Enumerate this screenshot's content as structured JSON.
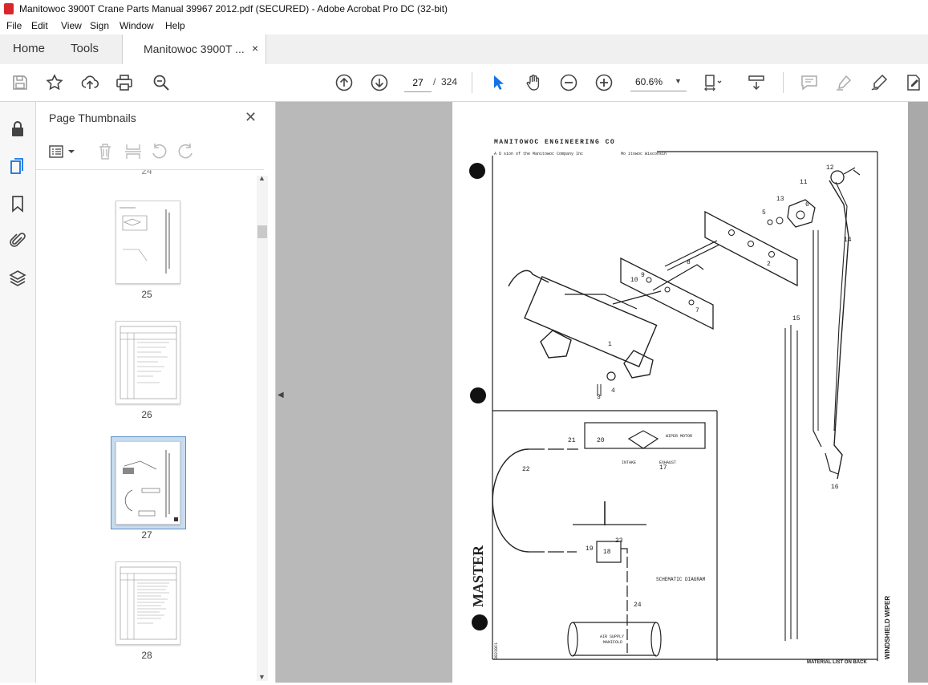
{
  "window": {
    "title": "Manitowoc 3900T Crane Parts Manual 39967 2012.pdf (SECURED) - Adobe Acrobat Pro DC (32-bit)"
  },
  "menu": [
    "File",
    "Edit",
    "View",
    "Sign",
    "Window",
    "Help"
  ],
  "tabs": {
    "home": "Home",
    "tools": "Tools",
    "document": "Manitowoc 3900T ...",
    "close": "×"
  },
  "toolbar": {
    "current_page": "27",
    "separator": "/",
    "total_pages": "324",
    "zoom": "60.6%",
    "icons": [
      "save-icon",
      "bookmark-star-icon",
      "upload-icon",
      "print-icon",
      "zoom-search-icon",
      "page-up-icon",
      "page-down-icon",
      "select-cursor-icon",
      "hand-icon",
      "zoom-out-icon",
      "zoom-in-icon",
      "page-fit-icon",
      "scroll-mode-icon",
      "comment-icon",
      "highlight-icon",
      "sign-icon",
      "edit-pdf-icon"
    ]
  },
  "panel": {
    "title": "Page Thumbnails",
    "close": "✕",
    "partial_label": "24",
    "thumbnails": [
      {
        "label": "25",
        "selected": false
      },
      {
        "label": "26",
        "selected": false
      },
      {
        "label": "27",
        "selected": true
      },
      {
        "label": "28",
        "selected": false
      }
    ]
  },
  "document_page": {
    "header": "MANITOWOC ENGINEERING CO",
    "subheader_left": "A D   sion of the Manitowoc Company Inc",
    "subheader_right": "Mo itowoc Wisconsin",
    "schematic_label": "SCHEMATIC DIAGRAM",
    "wiper_motor": "WIPER MOTOR",
    "intake": "INTAKE",
    "exhaust": "EXHAUST",
    "air_supply": "AIR SUPPLY",
    "manifold": "MANIFOLD",
    "material_list": "MATERIAL LIST ON BACK",
    "side_title": "WINDSHIELD WIPER",
    "stamp": "MASTER",
    "doc_number": "38230C1",
    "part_numbers": [
      "1",
      "2",
      "3",
      "4",
      "5",
      "6",
      "7",
      "8",
      "9",
      "10",
      "11",
      "12",
      "13",
      "14",
      "15",
      "16",
      "17",
      "18",
      "19",
      "20",
      "21",
      "22",
      "23",
      "24"
    ]
  },
  "colors": {
    "selected_thumb_bg": "#c8dcef",
    "doc_background": "#b9b9b9",
    "accent_blue": "#1473e6"
  }
}
